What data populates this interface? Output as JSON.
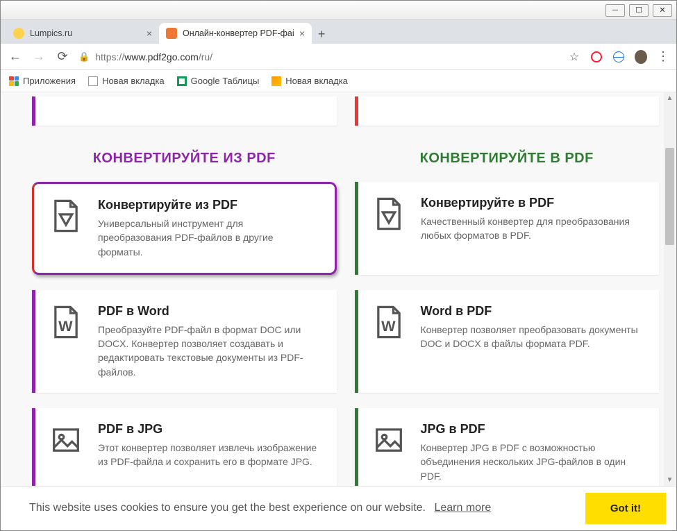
{
  "tabs": [
    {
      "title": "Lumpics.ru",
      "active": false
    },
    {
      "title": "Онлайн-конвертер PDF-файлов",
      "active": true
    }
  ],
  "url": {
    "scheme": "https://",
    "host": "www.pdf2go.com",
    "path": "/ru/"
  },
  "bookmarks": {
    "apps": "Приложения",
    "tab1": "Новая вкладка",
    "sheets": "Google Таблицы",
    "tab2": "Новая вкладка"
  },
  "section_heads": {
    "left": "КОНВЕРТИРУЙТЕ ИЗ PDF",
    "right": "КОНВЕРТИРУЙТЕ В PDF"
  },
  "cards": {
    "fromPdf": [
      {
        "title": "Конвертируйте из PDF",
        "desc": "Универсальный инструмент для преобразования PDF-файлов в другие форматы."
      },
      {
        "title": "PDF в Word",
        "desc": "Преобразуйте PDF-файл в формат DOC или DOCX. Конвертер позволяет создавать и редактировать текстовые документы из PDF-файлов."
      },
      {
        "title": "PDF в JPG",
        "desc": "Этот конвертер позволяет извлечь изображение из PDF-файла и сохранить его в формате JPG."
      }
    ],
    "toPdf": [
      {
        "title": "Конвертируйте в PDF",
        "desc": "Качественный конвертер для преобразования любых форматов в PDF."
      },
      {
        "title": "Word в PDF",
        "desc": "Конвертер позволяет преобразовать документы DOC и DOCX в файлы формата PDF."
      },
      {
        "title": "JPG в PDF",
        "desc": "Конвертер JPG в PDF с возможностью объединения нескольких JPG-файлов в один PDF."
      }
    ]
  },
  "cookie": {
    "text": "This website uses cookies to ensure you get the best experience on our website.",
    "learn": "Learn more",
    "gotit": "Got it!"
  }
}
